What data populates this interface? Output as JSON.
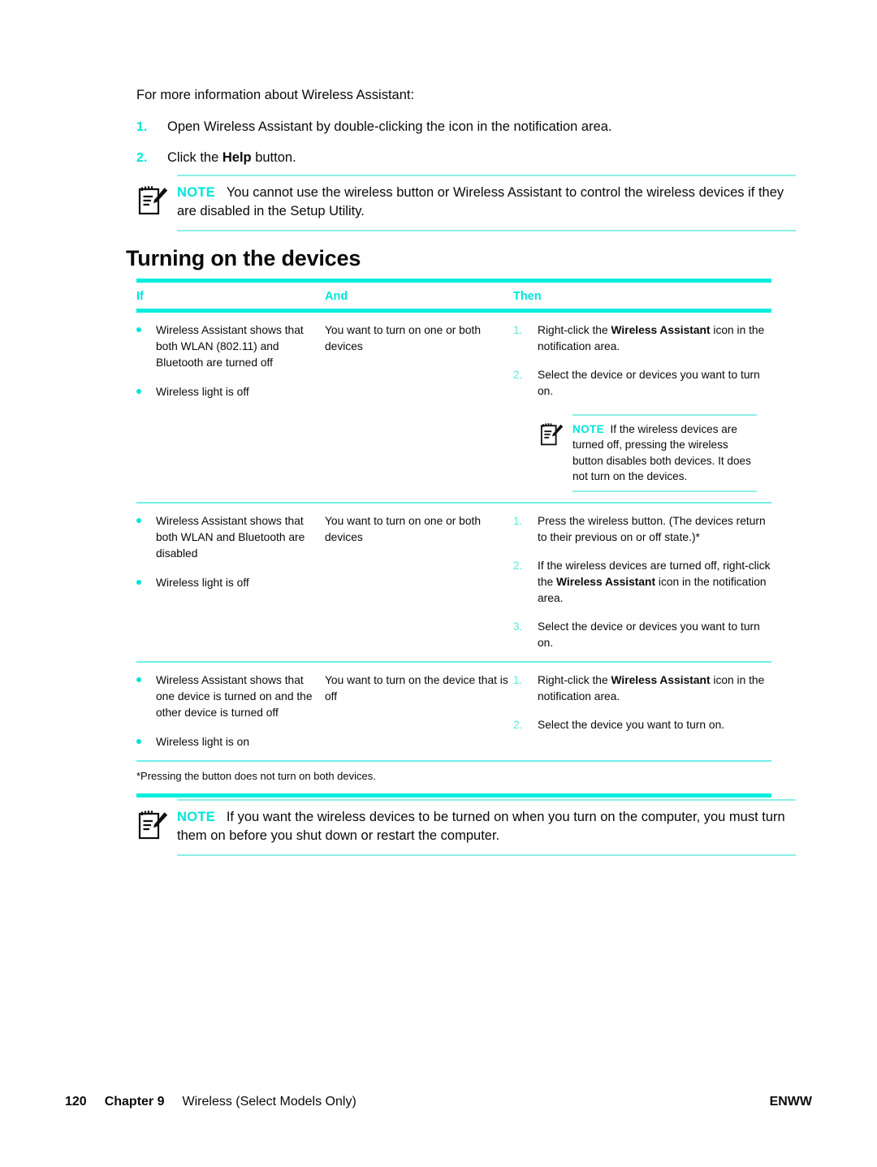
{
  "intro": {
    "lead": "For more information about Wireless Assistant:"
  },
  "steps": [
    {
      "num": "1.",
      "pre": "Open Wireless Assistant by double-clicking the icon in the notification area.",
      "bold": "",
      "post": ""
    },
    {
      "num": "2.",
      "pre": "Click the ",
      "bold": "Help",
      "post": " button."
    }
  ],
  "note_top": {
    "icon": "note-pencil-icon",
    "label": "NOTE",
    "text": "You cannot use the wireless button or Wireless Assistant to control the wireless devices if they are disabled in the Setup Utility."
  },
  "heading": "Turning on the devices",
  "table": {
    "headers": {
      "if": "If",
      "and": "And",
      "then": "Then"
    },
    "rows": [
      {
        "if_bullets": [
          "Wireless Assistant shows that both WLAN (802.11) and Bluetooth are turned off",
          "Wireless light is off"
        ],
        "and_text": "You want to turn on one or both devices",
        "then_steps": [
          {
            "num": "1.",
            "pre": "Right-click the ",
            "bold": "Wireless Assistant",
            "post": " icon in the notification area."
          },
          {
            "num": "2.",
            "pre": "Select the device or devices you want to turn on.",
            "bold": "",
            "post": ""
          }
        ],
        "then_note": {
          "icon": "note-pencil-icon",
          "label": "NOTE",
          "text": "If the wireless devices are turned off, pressing the wireless button disables both devices. It does not turn on the devices."
        }
      },
      {
        "if_bullets": [
          "Wireless Assistant shows that both WLAN and Bluetooth are disabled",
          "Wireless light is off"
        ],
        "and_text": "You want to turn on one or both devices",
        "then_steps": [
          {
            "num": "1.",
            "pre": "Press the wireless button. (The devices return to their previous on or off state.)*",
            "bold": "",
            "post": ""
          },
          {
            "num": "2.",
            "pre": "If the wireless devices are turned off, right-click the ",
            "bold": "Wireless Assistant",
            "post": " icon in the notification area."
          },
          {
            "num": "3.",
            "pre": "Select the device or devices you want to turn on.",
            "bold": "",
            "post": ""
          }
        ],
        "then_note": null
      },
      {
        "if_bullets": [
          "Wireless Assistant shows that one device is turned on and the other device is turned off",
          "Wireless light is on"
        ],
        "and_text": "You want to turn on the device that is off",
        "then_steps": [
          {
            "num": "1.",
            "pre": "Right-click the ",
            "bold": "Wireless Assistant",
            "post": " icon in the notification area."
          },
          {
            "num": "2.",
            "pre": "Select the device you want to turn on.",
            "bold": "",
            "post": ""
          }
        ],
        "then_note": null
      }
    ],
    "footnote": "*Pressing the button does not turn on both devices."
  },
  "note_bottom": {
    "icon": "note-pencil-icon",
    "label": "NOTE",
    "text": "If you want the wireless devices to be turned on when you turn on the computer, you must turn them on before you shut down or restart the computer."
  },
  "footer": {
    "page_number": "120",
    "chapter": "Chapter 9",
    "title": "Wireless (Select Models Only)",
    "language": "ENWW"
  },
  "colors": {
    "accent_cyan": "#00e5d8",
    "rule_thick": "#00eede",
    "rule_thin": "#6ff0e6",
    "note_rule": "#8defe6",
    "text": "#0a0a0a"
  }
}
